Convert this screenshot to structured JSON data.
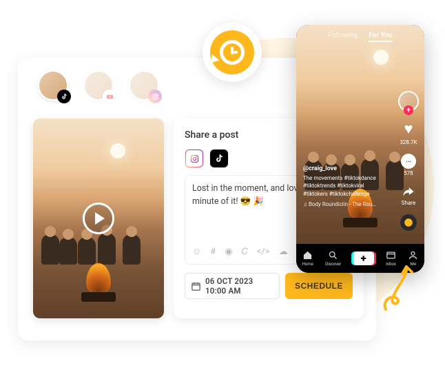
{
  "accounts": [
    {
      "platform": "tiktok",
      "active": true
    },
    {
      "platform": "youtube",
      "active": false
    },
    {
      "platform": "instagram",
      "active": false
    }
  ],
  "compose": {
    "title": "Share a post",
    "platforms": [
      "instagram",
      "tiktok"
    ],
    "text": "Lost in the moment, and loving every minute of it! 😎 🎉",
    "toolbar": [
      "☺",
      "#",
      "◉",
      "𝐶",
      "</>",
      "☁"
    ]
  },
  "schedule": {
    "date_label": "06 OCT 2023 10:00 AM",
    "button": "SCHEDULE"
  },
  "phone": {
    "tabs": {
      "following": "Following",
      "foryou": "For You"
    },
    "likes": "328.7K",
    "comments": "578",
    "share": "Share",
    "user": "@craig_love",
    "caption": "The movements #tiktokdance #tiktoktrends #tiktokviral #tiktokers #tiktokchallenge",
    "music": "♫ Body Roundiciin - The Rou…",
    "nav": {
      "home": "Home",
      "discover": "Discover",
      "inbox": "Inbox",
      "me": "Me"
    }
  }
}
